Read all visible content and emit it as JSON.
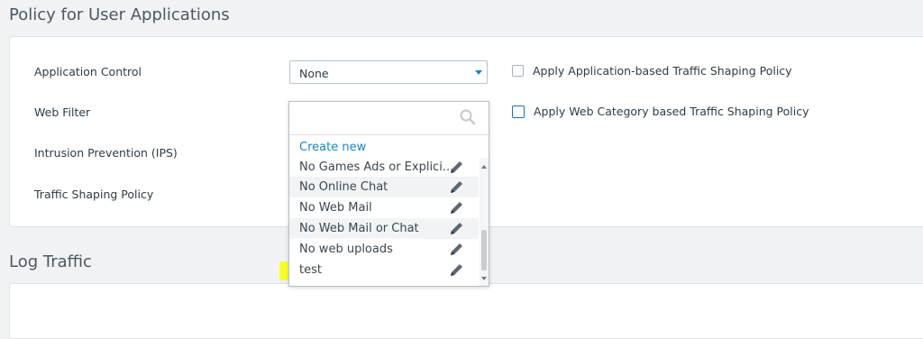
{
  "policy_section": {
    "title": "Policy for User Applications",
    "fields": [
      {
        "label": "Application Control"
      },
      {
        "label": "Web Filter"
      },
      {
        "label": "Intrusion Prevention (IPS)"
      },
      {
        "label": "Traffic Shaping Policy"
      }
    ],
    "app_control_select": {
      "value": "None"
    },
    "app_shaping_checkbox": {
      "label": "Apply Application-based Traffic Shaping Policy",
      "checked": false
    },
    "web_shaping_checkbox": {
      "label": "Apply Web Category based Traffic Shaping Policy",
      "checked": false
    }
  },
  "web_filter_dropdown": {
    "search_placeholder": "",
    "create_new": "Create new",
    "options": [
      {
        "label": "No Games Ads or Explici..."
      },
      {
        "label": "No Online Chat"
      },
      {
        "label": "No Web Mail"
      },
      {
        "label": "No Web Mail or Chat"
      },
      {
        "label": "No web uploads"
      },
      {
        "label": "test"
      }
    ]
  },
  "log_section": {
    "title": "Log Traffic"
  },
  "colors": {
    "accent": "#1b83c6",
    "highlight": "#f6ff1f",
    "background": "#f1f2f4"
  }
}
